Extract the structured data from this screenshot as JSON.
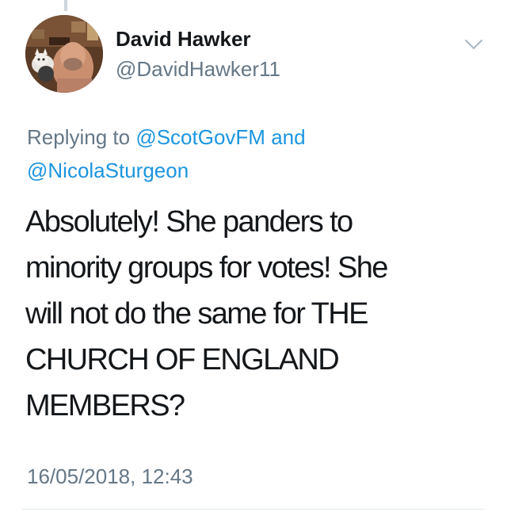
{
  "tweet": {
    "author_name": "David Hawker",
    "author_handle": "@DavidHawker11",
    "replying_prefix": "Replying to",
    "reply_to_1": "@ScotGovFM",
    "reply_conjunction": "and",
    "reply_to_2": "@NicolaSturgeon",
    "text_lines": [
      "Absolutely! She panders to",
      "minority groups for votes! She",
      "will not do the same for THE",
      "CHURCH OF ENGLAND",
      "MEMBERS?"
    ],
    "timestamp": "16/05/2018, 12:43"
  },
  "icons": {
    "menu_caret": "chevron-down-icon",
    "avatar": "profile-photo"
  },
  "colors": {
    "text_primary": "#14171a",
    "text_secondary": "#657786",
    "link": "#1b95e0",
    "divider": "#e1e8ed",
    "thread_line": "#ccd6dd"
  }
}
